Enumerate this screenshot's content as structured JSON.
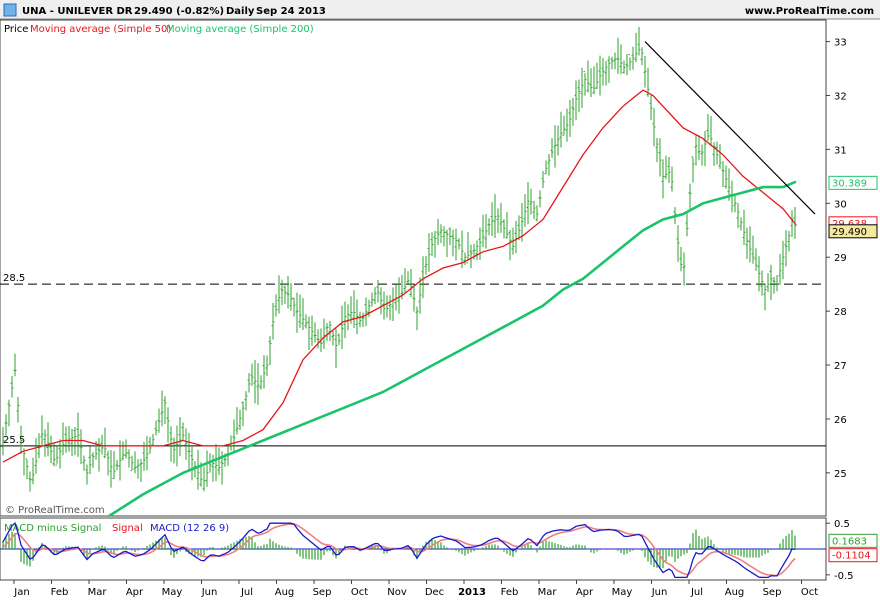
{
  "header": {
    "ticker": "UNA - UNILEVER DR",
    "price": "29.490 (-0.82%)",
    "period": "Daily",
    "date": "Sep 24 2013",
    "site": "www.ProRealTime.com"
  },
  "watermark": "© ProRealTime.com",
  "colors": {
    "bars": "#2fa12f",
    "ma50": "#e8161b",
    "ma200": "#19c46b",
    "macd": "#1a1acc",
    "signal": "#f08080",
    "histogram": "#2fa12f",
    "last_price_bg": "#f5e9a0"
  },
  "chart_data": [
    {
      "type": "line",
      "subtype": "ohlc-bars",
      "legend": [
        "Price",
        "Moving average (Simple 50)",
        "Moving average (Simple 200)"
      ],
      "x_axis_labels": [
        "Jan",
        "Feb",
        "Mar",
        "Apr",
        "May",
        "Jun",
        "Jul",
        "Aug",
        "Sep",
        "Oct",
        "Nov",
        "Dec",
        "2013",
        "Feb",
        "Mar",
        "Apr",
        "May",
        "Jun",
        "Jul",
        "Aug",
        "Sep",
        "Oct"
      ],
      "y_ticks": [
        25,
        26,
        27,
        28,
        29,
        30,
        31,
        32,
        33
      ],
      "ylim": [
        24.2,
        33.4
      ],
      "price_path": [
        [
          0,
          25.6
        ],
        [
          12,
          26.9
        ],
        [
          18,
          25.6
        ],
        [
          28,
          24.8
        ],
        [
          40,
          25.8
        ],
        [
          52,
          25.2
        ],
        [
          62,
          25.6
        ],
        [
          75,
          25.7
        ],
        [
          84,
          25.0
        ],
        [
          90,
          25.3
        ],
        [
          101,
          25.5
        ],
        [
          110,
          25.0
        ],
        [
          122,
          25.4
        ],
        [
          132,
          25.1
        ],
        [
          140,
          25.2
        ],
        [
          148,
          25.5
        ],
        [
          155,
          25.9
        ],
        [
          162,
          26.3
        ],
        [
          170,
          25.4
        ],
        [
          180,
          25.7
        ],
        [
          190,
          25.2
        ],
        [
          200,
          24.8
        ],
        [
          208,
          25.2
        ],
        [
          216,
          25.1
        ],
        [
          224,
          25.3
        ],
        [
          232,
          25.7
        ],
        [
          240,
          26.2
        ],
        [
          248,
          26.8
        ],
        [
          256,
          26.6
        ],
        [
          264,
          27.0
        ],
        [
          270,
          27.8
        ],
        [
          278,
          28.4
        ],
        [
          286,
          28.3
        ],
        [
          294,
          28.0
        ],
        [
          302,
          27.8
        ],
        [
          310,
          27.6
        ],
        [
          318,
          27.4
        ],
        [
          326,
          27.8
        ],
        [
          334,
          27.3
        ],
        [
          342,
          27.9
        ],
        [
          350,
          28.0
        ],
        [
          358,
          27.8
        ],
        [
          366,
          28.1
        ],
        [
          374,
          28.4
        ],
        [
          382,
          28.0
        ],
        [
          390,
          28.2
        ],
        [
          398,
          28.3
        ],
        [
          406,
          28.6
        ],
        [
          414,
          28.0
        ],
        [
          422,
          28.8
        ],
        [
          430,
          29.3
        ],
        [
          438,
          29.5
        ],
        [
          446,
          29.4
        ],
        [
          454,
          29.3
        ],
        [
          462,
          29.0
        ],
        [
          470,
          29.1
        ],
        [
          478,
          29.3
        ],
        [
          486,
          29.6
        ],
        [
          494,
          29.8
        ],
        [
          502,
          29.5
        ],
        [
          510,
          29.2
        ],
        [
          518,
          29.6
        ],
        [
          526,
          30.1
        ],
        [
          534,
          29.8
        ],
        [
          542,
          30.6
        ],
        [
          550,
          31.0
        ],
        [
          558,
          31.3
        ],
        [
          566,
          31.5
        ],
        [
          574,
          32.0
        ],
        [
          582,
          32.3
        ],
        [
          590,
          32.1
        ],
        [
          598,
          32.4
        ],
        [
          606,
          32.6
        ],
        [
          614,
          32.7
        ],
        [
          622,
          32.5
        ],
        [
          630,
          32.7
        ],
        [
          638,
          32.9
        ],
        [
          646,
          32.0
        ],
        [
          652,
          31.3
        ],
        [
          660,
          30.5
        ],
        [
          668,
          30.6
        ],
        [
          674,
          29.4
        ],
        [
          680,
          28.6
        ],
        [
          686,
          30.0
        ],
        [
          692,
          31.1
        ],
        [
          698,
          30.9
        ],
        [
          706,
          31.3
        ],
        [
          712,
          31.0
        ],
        [
          718,
          30.7
        ],
        [
          726,
          30.3
        ],
        [
          734,
          29.9
        ],
        [
          742,
          29.4
        ],
        [
          750,
          29.0
        ],
        [
          756,
          28.7
        ],
        [
          762,
          28.4
        ],
        [
          768,
          28.6
        ],
        [
          774,
          28.5
        ],
        [
          780,
          29.0
        ],
        [
          786,
          29.4
        ],
        [
          790,
          29.8
        ],
        [
          793,
          29.49
        ]
      ],
      "series": [
        {
          "name": "Moving average (Simple 50)",
          "points": [
            [
              0,
              25.2
            ],
            [
              20,
              25.4
            ],
            [
              40,
              25.5
            ],
            [
              60,
              25.6
            ],
            [
              80,
              25.6
            ],
            [
              100,
              25.5
            ],
            [
              120,
              25.5
            ],
            [
              140,
              25.5
            ],
            [
              160,
              25.5
            ],
            [
              180,
              25.6
            ],
            [
              200,
              25.5
            ],
            [
              220,
              25.5
            ],
            [
              240,
              25.6
            ],
            [
              260,
              25.8
            ],
            [
              280,
              26.3
            ],
            [
              300,
              27.1
            ],
            [
              320,
              27.5
            ],
            [
              340,
              27.8
            ],
            [
              360,
              27.9
            ],
            [
              380,
              28.1
            ],
            [
              400,
              28.3
            ],
            [
              420,
              28.6
            ],
            [
              440,
              28.8
            ],
            [
              460,
              28.9
            ],
            [
              480,
              29.1
            ],
            [
              500,
              29.2
            ],
            [
              520,
              29.4
            ],
            [
              540,
              29.7
            ],
            [
              560,
              30.3
            ],
            [
              580,
              30.9
            ],
            [
              600,
              31.4
            ],
            [
              620,
              31.8
            ],
            [
              640,
              32.1
            ],
            [
              650,
              32.0
            ],
            [
              660,
              31.8
            ],
            [
              670,
              31.6
            ],
            [
              680,
              31.4
            ],
            [
              700,
              31.2
            ],
            [
              720,
              30.9
            ],
            [
              740,
              30.5
            ],
            [
              760,
              30.2
            ],
            [
              780,
              29.9
            ],
            [
              793,
              29.6
            ]
          ]
        },
        {
          "name": "Moving average (Simple 200)",
          "points": [
            [
              106,
              24.2
            ],
            [
              140,
              24.6
            ],
            [
              180,
              25.0
            ],
            [
              220,
              25.3
            ],
            [
              260,
              25.6
            ],
            [
              300,
              25.9
            ],
            [
              340,
              26.2
            ],
            [
              380,
              26.5
            ],
            [
              420,
              26.9
            ],
            [
              460,
              27.3
            ],
            [
              500,
              27.7
            ],
            [
              540,
              28.1
            ],
            [
              560,
              28.4
            ],
            [
              580,
              28.6
            ],
            [
              600,
              28.9
            ],
            [
              620,
              29.2
            ],
            [
              640,
              29.5
            ],
            [
              660,
              29.7
            ],
            [
              680,
              29.8
            ],
            [
              700,
              30.0
            ],
            [
              720,
              30.1
            ],
            [
              740,
              30.2
            ],
            [
              760,
              30.3
            ],
            [
              780,
              30.3
            ],
            [
              793,
              30.4
            ]
          ]
        }
      ],
      "horizontal_lines": [
        {
          "value": 28.5,
          "label": "28.5",
          "style": "dashed"
        },
        {
          "value": 25.5,
          "label": "25.5",
          "style": "solid"
        }
      ],
      "trendline": [
        [
          642,
          33.0
        ],
        [
          812,
          29.8
        ]
      ],
      "price_labels": [
        {
          "value": 30.389,
          "text": "30.389",
          "color": "#19c46b"
        },
        {
          "value": 29.638,
          "text": "29.638",
          "color": "#e8161b"
        },
        {
          "value": 29.49,
          "text": "29.490",
          "color": "#000000"
        }
      ]
    },
    {
      "type": "line",
      "legend": [
        "MACD minus Signal",
        "Signal",
        "MACD (12 26 9)"
      ],
      "y_ticks": [
        0.5,
        -0.5
      ],
      "ylim": [
        -0.6,
        0.6
      ],
      "price_labels": [
        {
          "value": 0.1683,
          "text": "0.1683",
          "color": "#2fa12f"
        },
        {
          "value": -0.1104,
          "text": "-0.1104",
          "color": "#e8161b"
        }
      ]
    }
  ]
}
